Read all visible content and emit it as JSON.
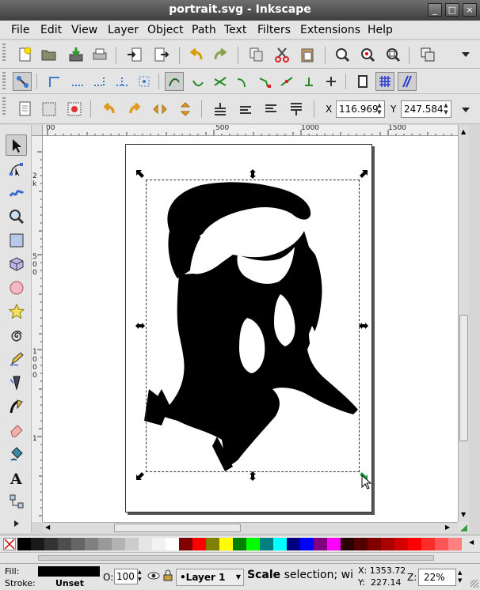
{
  "window": {
    "title": "portrait.svg - Inkscape"
  },
  "menu": [
    "File",
    "Edit",
    "View",
    "Layer",
    "Object",
    "Path",
    "Text",
    "Filters",
    "Extensions",
    "Help"
  ],
  "coords": {
    "x_label": "X",
    "x_value": "116.969",
    "y_label": "Y",
    "y_value": "247.584"
  },
  "ruler": {
    "h": [
      "00",
      "500",
      "1000",
      "1500"
    ],
    "v": [
      "2",
      "k",
      "5",
      "0",
      "0",
      "1",
      "0",
      "0",
      "0",
      "1"
    ]
  },
  "status": {
    "fill_label": "Fill:",
    "stroke_label": "Stroke:",
    "stroke_value": "Unset",
    "opacity_label": "O:",
    "opacity_value": "100",
    "layer": "•Layer 1",
    "message_bold": "Scale",
    "message": " selection; wi",
    "cursor_x": "X: 1353.72",
    "cursor_y": "Y:  227.14",
    "zoom_label": "Z:",
    "zoom_value": "22%"
  },
  "palette_colors": [
    "#000000",
    "#1a1a1a",
    "#333333",
    "#4d4d4d",
    "#666666",
    "#808080",
    "#999999",
    "#b3b3b3",
    "#cccccc",
    "#e6e6e6",
    "#f2f2f2",
    "#ffffff",
    "#800000",
    "#ff0000",
    "#808000",
    "#ffff00",
    "#008000",
    "#00ff00",
    "#008080",
    "#00ffff",
    "#000080",
    "#0000ff",
    "#800080",
    "#ff00ff",
    "#2b0000",
    "#550000",
    "#800000",
    "#aa0000",
    "#d40000",
    "#ff0000",
    "#ff2a2a",
    "#ff5555",
    "#ff8080"
  ]
}
